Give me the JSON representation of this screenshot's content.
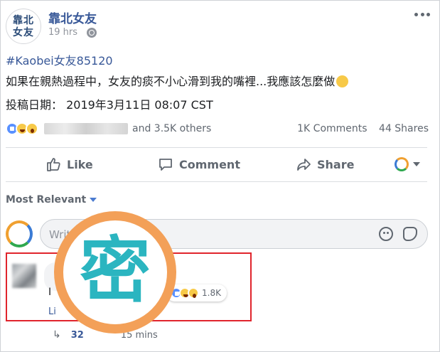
{
  "post": {
    "page_name": "靠北女友",
    "avatar_text_line1": "靠北",
    "avatar_text_line2": "女友",
    "time": "19 hrs",
    "hashtag": "#Kaobei女友85120",
    "body_line1": "如果在親熱過程中，女友的痰不小心滑到我的嘴裡...我應該怎麼做",
    "body_line2": "投稿日期：  2019年3月11日 08:07 CST"
  },
  "summary": {
    "reaction_icons": [
      "like-reaction-icon",
      "haha-reaction-icon",
      "wow-reaction-icon"
    ],
    "others_text": "and 3.5K others",
    "comments": "1K Comments",
    "shares": "44 Shares"
  },
  "actions": {
    "like": "Like",
    "comment": "Comment",
    "share": "Share"
  },
  "comments_section": {
    "sort_label": "Most Relevant",
    "input_placeholder": "Write a comment...",
    "top_comment": {
      "partial_letter": "I",
      "reaction_count": "1.8K",
      "like_label": "Li"
    },
    "replies_partial": "32",
    "reply_time_partial": "15 mins"
  },
  "watermark": {
    "character": "密"
  },
  "colors": {
    "link_blue": "#385898",
    "highlight_red": "#e0242c",
    "stamp_orange": "#f3a058",
    "stamp_teal": "#2bb5c0"
  }
}
